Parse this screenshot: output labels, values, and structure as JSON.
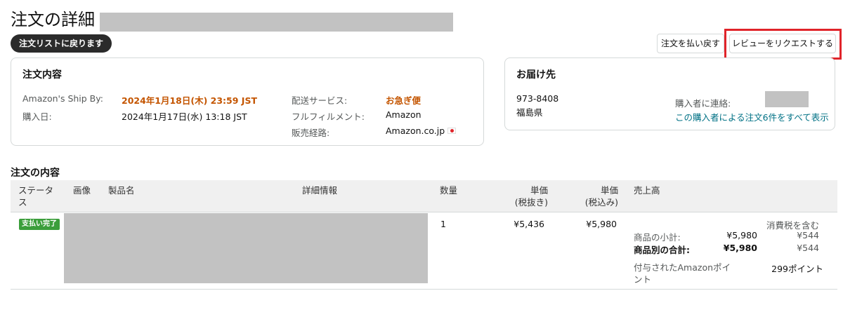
{
  "page": {
    "title": "注文の詳細",
    "back_label": "注文リストに戻ります"
  },
  "actions": {
    "refund_label": "注文を払い戻す",
    "review_label": "レビューをリクエストする",
    "highlight_color": "#e0242a"
  },
  "order_summary": {
    "heading": "注文内容",
    "ship_by_label": "Amazon's Ship By:",
    "ship_by_value": "2024年1月18日(木) 23:59 JST",
    "purchase_date_label": "購入日:",
    "purchase_date_value": "2024年1月17日(水) 13:18 JST",
    "shipping_service_label": "配送サービス:",
    "shipping_service_value": "お急ぎ便",
    "fulfillment_label": "フルフィルメント:",
    "fulfillment_value": "Amazon",
    "sales_channel_label": "販売経路:",
    "sales_channel_value": "Amazon.co.jp"
  },
  "ship_to": {
    "heading": "お届け先",
    "postal_code": "973-8408",
    "prefecture": "福島県",
    "contact_label": "購入者に連絡:",
    "orders_link": "この購入者による注文6件をすべて表示"
  },
  "items": {
    "heading": "注文の内容",
    "columns": {
      "status": [
        "ステータ",
        "ス"
      ],
      "image": "画像",
      "product_name": "製品名",
      "details": "詳細情報",
      "quantity": "数量",
      "unit_price_ex": [
        "単価",
        "(税抜き)"
      ],
      "unit_price_in": [
        "単価",
        "(税込み)"
      ],
      "sales": "売上高"
    },
    "row": {
      "status_badge": "支払い完了",
      "quantity": "1",
      "unit_price_ex": "¥5,436",
      "unit_price_in": "¥5,980",
      "tax_included_label": "消費税を含む",
      "subtotal_label": "商品の小計:",
      "subtotal_value": "¥5,980",
      "subtotal_tax": "¥544",
      "item_total_label": "商品別の合計:",
      "item_total_value": "¥5,980",
      "item_total_tax": "¥544",
      "points_label": [
        "付与されたAmazonポイ",
        "ント"
      ],
      "points_value": "299ポイント"
    }
  }
}
